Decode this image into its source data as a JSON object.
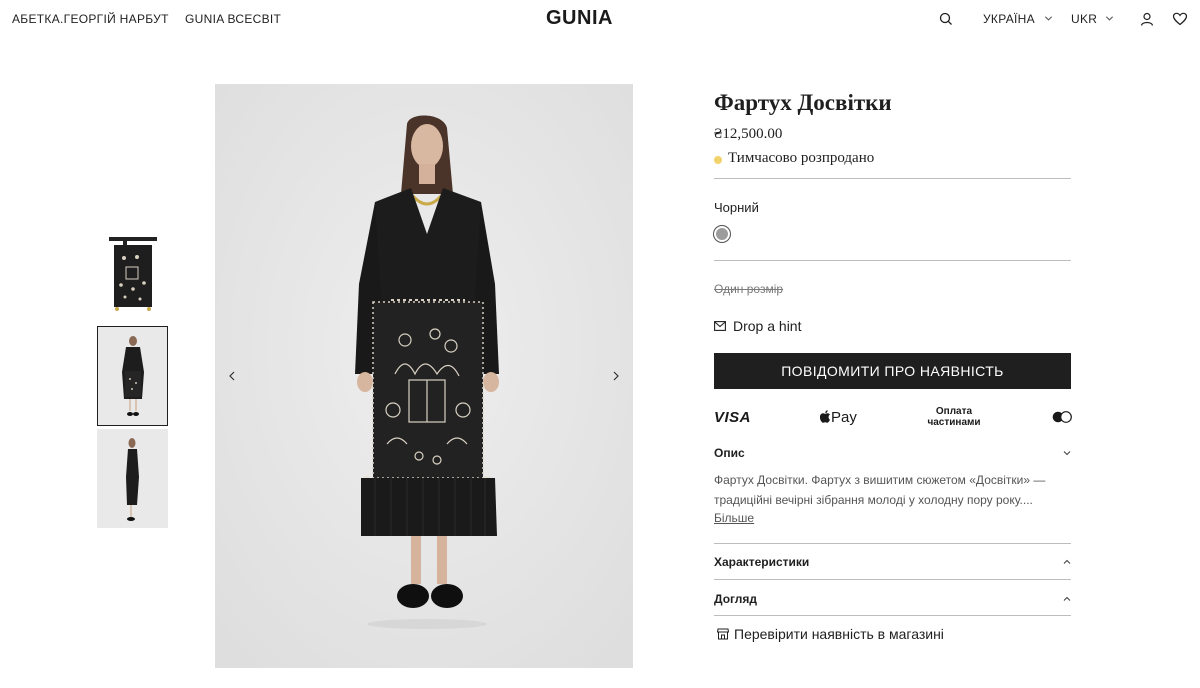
{
  "header": {
    "nav": [
      "АБЕТКА.ГЕОРГІЙ НАРБУТ",
      "GUNIA ВСЕСВІТ"
    ],
    "logo": "GUNIA",
    "region": "УКРАЇНА",
    "language": "UKR",
    "icons": [
      "search-icon",
      "user-icon",
      "heart-icon"
    ]
  },
  "gallery": {
    "thumbnails": [
      "apron-flatlay",
      "model-front",
      "model-side"
    ],
    "active_index": 1
  },
  "product": {
    "title": "Фартух Досвітки",
    "price": "₴12,500.00",
    "status": "Тимчасово розпродано",
    "status_color": "#f2d26b",
    "color_label": "Чорний",
    "size": "Один розмір",
    "hint": "Drop a hint",
    "notify_button": "ПОВІДОМИТИ ПРО НАЯВНІСТЬ",
    "payments": {
      "visa": "VISA",
      "applepay": "Pay",
      "installments_line1": "Оплата",
      "installments_line2": "частинами"
    },
    "description": {
      "title": "Опис",
      "text": "Фартух Досвітки. Фартух з вишитим сюжетом «Досвітки» — традиційні вечірні зібрання молоді у холодну пору року....",
      "more": "Більше"
    },
    "characteristics": "Характеристики",
    "care": "Догляд",
    "store_check": "Перевірити наявність в магазині"
  }
}
